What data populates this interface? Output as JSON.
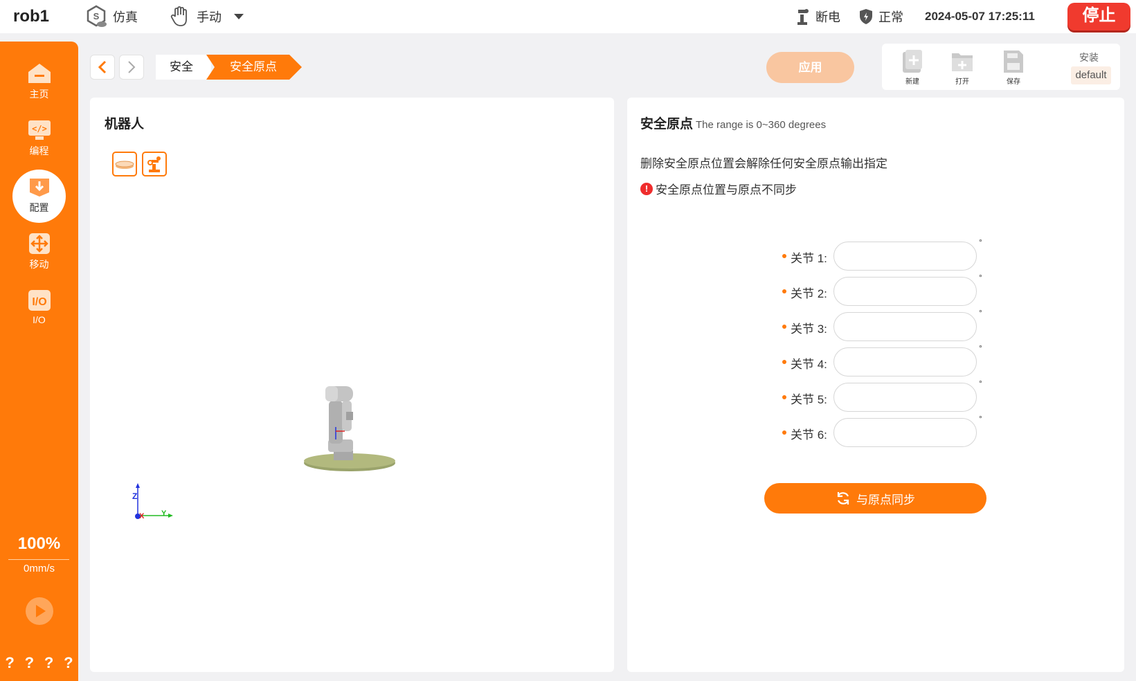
{
  "header": {
    "robot_name": "rob1",
    "sim_label": "仿真",
    "mode_label": "手动",
    "power_label": "断电",
    "status_label": "正常",
    "datetime": "2024-05-07 17:25:11",
    "stop_label": "停止"
  },
  "sidebar": {
    "items": [
      {
        "label": "主页",
        "icon": "home-icon"
      },
      {
        "label": "编程",
        "icon": "code-icon"
      },
      {
        "label": "配置",
        "icon": "config-icon"
      },
      {
        "label": "移动",
        "icon": "move-icon"
      },
      {
        "label": "I/O",
        "icon": "io-icon"
      }
    ],
    "active_index": 2,
    "speed_percent": "100%",
    "speed_value": "0mm/s",
    "help_marks": [
      "?",
      "?",
      "?",
      "?"
    ]
  },
  "breadcrumb": {
    "items": [
      "安全",
      "安全原点"
    ]
  },
  "toolbar": {
    "apply_label": "应用",
    "new_label": "新建",
    "open_label": "打开",
    "save_label": "保存",
    "install_label": "安装",
    "install_value": "default"
  },
  "left_panel": {
    "title": "机器人",
    "axes": {
      "z": "Z",
      "x": "X",
      "y": "Y"
    }
  },
  "right_panel": {
    "title": "安全原点",
    "range_note": "The range is 0~360 degrees",
    "description": "删除安全原点位置会解除任何安全原点输出指定",
    "warning": "安全原点位置与原点不同步",
    "joints": [
      {
        "label": "关节 1:",
        "value": "",
        "unit": "°"
      },
      {
        "label": "关节 2:",
        "value": "",
        "unit": "°"
      },
      {
        "label": "关节 3:",
        "value": "",
        "unit": "°"
      },
      {
        "label": "关节 4:",
        "value": "",
        "unit": "°"
      },
      {
        "label": "关节 5:",
        "value": "",
        "unit": "°"
      },
      {
        "label": "关节 6:",
        "value": "",
        "unit": "°"
      }
    ],
    "sync_label": "与原点同步"
  },
  "colors": {
    "accent": "#ff7a0a",
    "stop": "#f03a2e",
    "apply_disabled": "#f9c6a0",
    "warning": "#ef2d2d"
  }
}
